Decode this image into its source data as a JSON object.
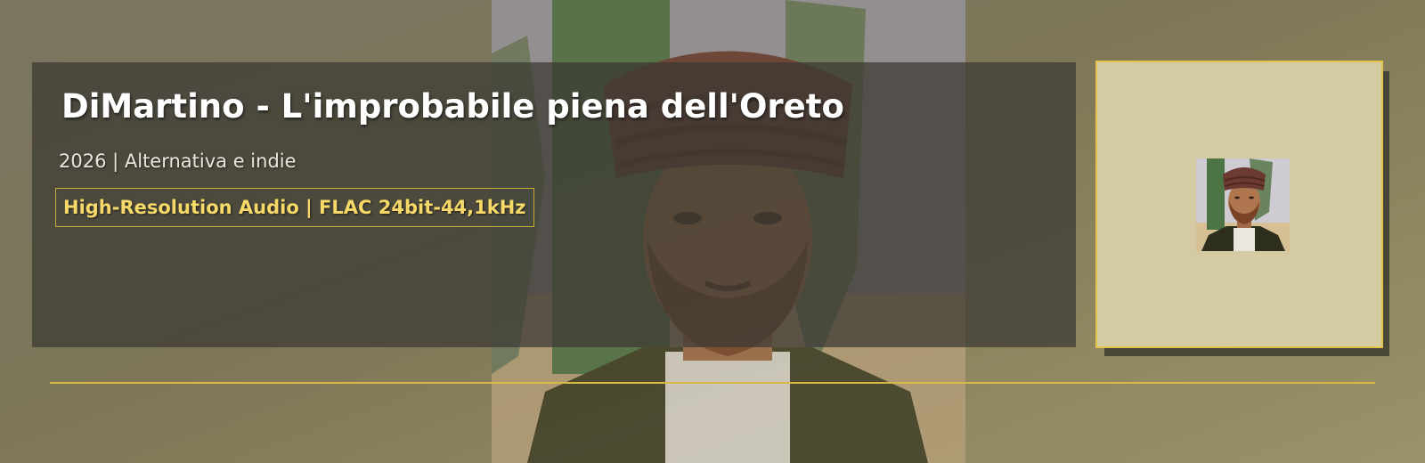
{
  "album": {
    "title": "DiMartino - L'improbabile piena dell'Oreto",
    "meta": "2026 | Alternativa e indie",
    "quality_badge": "High-Resolution Audio | FLAC 24bit-44,1kHz"
  },
  "colors": {
    "accent_gold": "#d9b945",
    "badge_text": "#f7d96a",
    "cover_background": "#d4cba2"
  },
  "icons": {
    "background": "album-artwork-backdrop",
    "cover": "album-cover-thumbnail"
  }
}
